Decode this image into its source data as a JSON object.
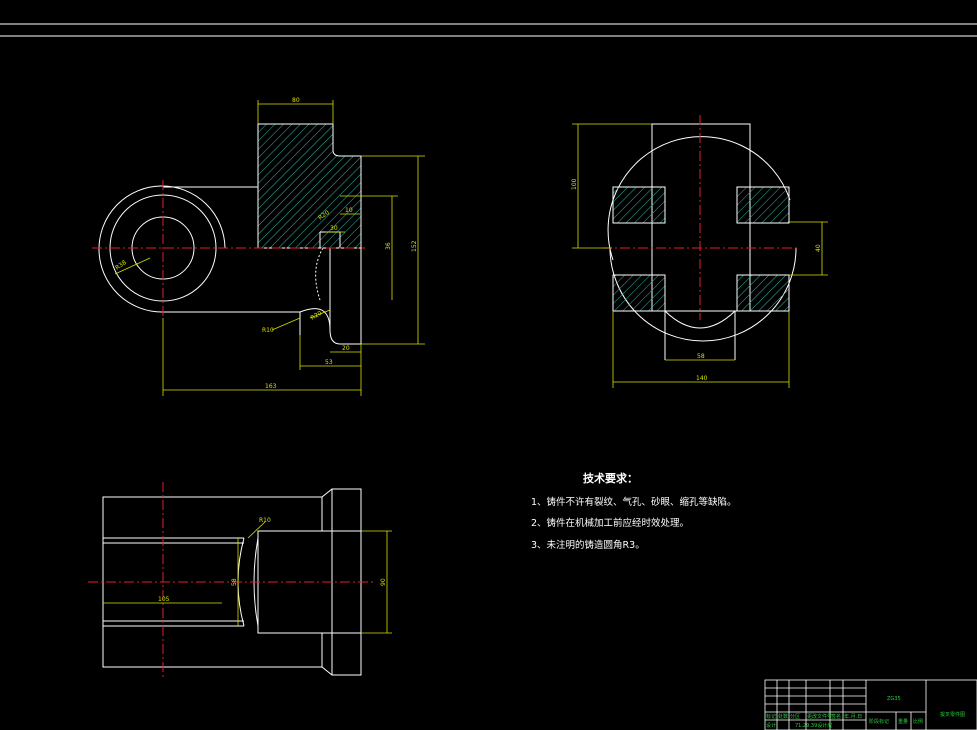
{
  "colors": {
    "background": "#000000",
    "outline": "#ffffff",
    "dimension": "#d8e000",
    "centerline": "#e0202a",
    "hatch": "#2fb3a3",
    "titleblock_text": "#2ecc40"
  },
  "front_view": {
    "dims": {
      "top_width": "80",
      "d_10": "10",
      "d_30": "30",
      "d_36": "36",
      "h_152": "152",
      "r_38": "R38",
      "r_10": "R10",
      "a_20": "R20",
      "d_20": "20",
      "d_53": "53",
      "d_163": "163"
    }
  },
  "side_view": {
    "dims": {
      "h_100": "100",
      "d_40": "40",
      "d_58": "58",
      "d_140": "140"
    }
  },
  "plan_view": {
    "dims": {
      "r_10": "R10",
      "d_105": "105",
      "d_58": "58",
      "d_90": "90"
    }
  },
  "notes": {
    "title": "技术要求：",
    "items": [
      "1、铸件不许有裂纹、气孔、砂眼、缩孔等缺陷。",
      "2、铸件在机械加工前应经时效处理。",
      "3、未注明的铸造圆角R3。"
    ]
  },
  "title_block": {
    "material": "ZG35",
    "drawing_name": "拔叉零件图",
    "row_labels": [
      "标记",
      "处数",
      "分区",
      "更改文件号",
      "签名",
      "年.月.日"
    ],
    "design_label": "设计",
    "design_value": "71.29.39设计成",
    "stage_label": "阶段标记",
    "weight_label": "重量",
    "scale_label": "比例"
  }
}
